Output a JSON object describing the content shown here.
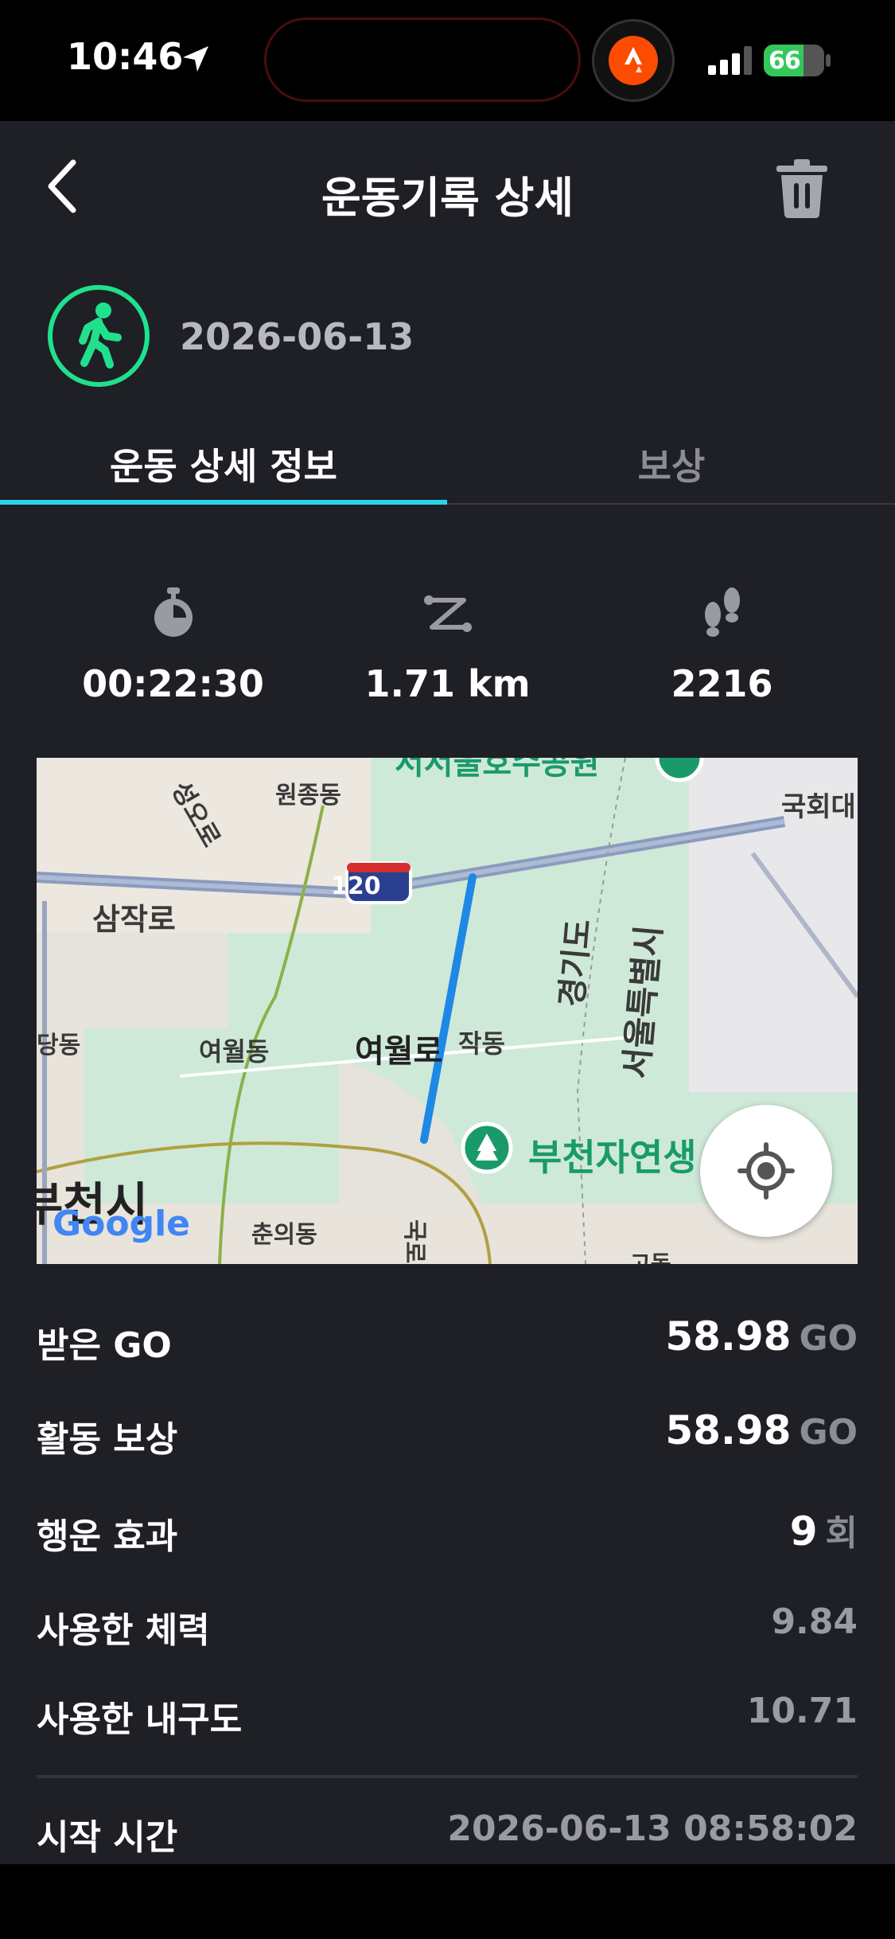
{
  "status_bar": {
    "time": "10:46",
    "battery": "66",
    "battery_level": 0.66
  },
  "header": {
    "title": "운동기록 상세"
  },
  "activity": {
    "date": "2026-06-13",
    "accent_color": "#20e08c"
  },
  "tabs": [
    {
      "label": "운동 상세 정보",
      "active": true
    },
    {
      "label": "보상",
      "active": false
    }
  ],
  "stats": {
    "duration": "00:22:30",
    "distance": "1.71 km",
    "steps": "2216"
  },
  "map": {
    "labels": {
      "seongo": "성오로",
      "wonjong": "원종동",
      "samjak": "삼작로",
      "dangdong": "당동",
      "yeowol_dong": "여월동",
      "yeowol_ro": "여월로",
      "jakdong": "작동",
      "gyeonggi": "경기도",
      "seoul": "서울특별시",
      "park": "부천자연생",
      "bucheon": "부천시",
      "chunui": "춘의동",
      "gukhoe": "국회대",
      "highway": "120",
      "road_bottom": "국로",
      "top_road": "서서울호수공원",
      "bottom_right": "고동"
    },
    "attribution": "Google",
    "route_color": "#1e88e5"
  },
  "rewards": {
    "received_go_label": "받은 GO",
    "received_go_value": "58.98",
    "received_go_unit": "GO",
    "activity_reward_label": "활동 보상",
    "activity_reward_value": "58.98",
    "activity_reward_unit": "GO",
    "luck_label": "행운 효과",
    "luck_value": "9",
    "luck_unit": "회",
    "energy_label": "사용한 체력",
    "energy_value": "9.84",
    "durability_label": "사용한 내구도",
    "durability_value": "10.71",
    "start_time_label": "시작 시간",
    "start_time_value": "2026-06-13 08:58:02"
  }
}
